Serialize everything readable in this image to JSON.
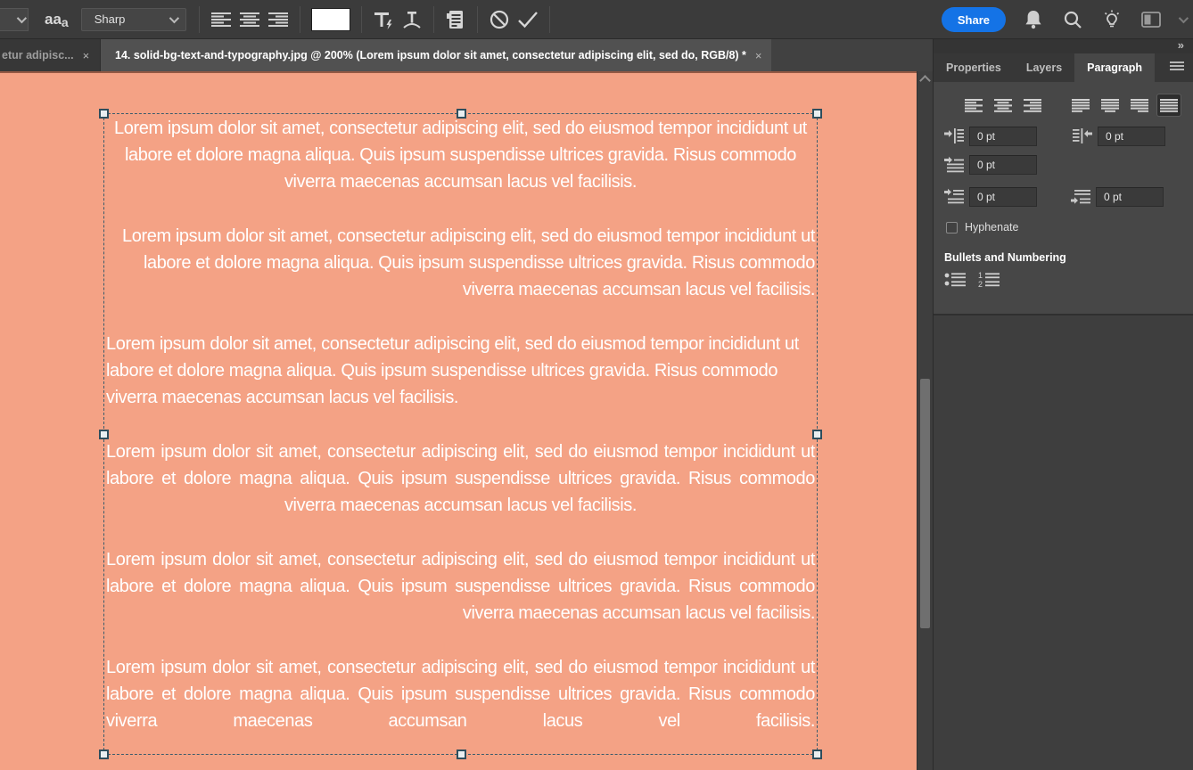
{
  "options_bar": {
    "anti_alias_icon_text": "aa",
    "anti_alias_value": "Sharp",
    "swatch_color": "#ffffff"
  },
  "header_right": {
    "share_label": "Share"
  },
  "document_tabs": {
    "inactive_title": "etur adipisc...",
    "active_title": "14. solid-bg-text-and-typography.jpg @ 200% (Lorem ipsum dolor sit amet, consectetur adipiscing elit, sed do, RGB/8) *",
    "close_glyph": "×"
  },
  "dock": {
    "expand_glyph": "»",
    "tabs": [
      {
        "label": "Properties"
      },
      {
        "label": "Layers"
      },
      {
        "label": "Paragraph"
      }
    ],
    "paragraph_panel": {
      "indent_left": "0 pt",
      "indent_right": "0 pt",
      "indent_first_line": "0 pt",
      "space_before": "0 pt",
      "space_after": "0 pt",
      "hyphenate_label": "Hyphenate",
      "hyphenate_checked": false,
      "bullets_heading": "Bullets and Numbering",
      "selected_alignment": "justify-all"
    }
  },
  "canvas": {
    "background_color": "#F4A285",
    "text_color": "#FFFFFF",
    "zoom_level": "200%",
    "paragraphs": [
      {
        "align": "center",
        "text": "Lorem ipsum dolor sit amet, consectetur adipiscing elit, sed do eiusmod tempor incididunt ut labore et dolore magna aliqua. Quis ipsum suspendisse ultrices gravida. Risus commodo viverra maecenas accumsan lacus vel facilisis."
      },
      {
        "align": "right",
        "text": "Lorem ipsum dolor sit amet, consectetur adipiscing elit, sed do eiusmod tempor incididunt ut labore et dolore magna aliqua. Quis ipsum suspendisse ultrices gravida. Risus commodo viverra maecenas accumsan lacus vel facilisis."
      },
      {
        "align": "left",
        "text": "Lorem ipsum dolor sit amet, consectetur adipiscing elit, sed do eiusmod tempor incididunt ut labore et dolore magna aliqua. Quis ipsum suspendisse ultrices gravida. Risus commodo viverra maecenas accumsan lacus vel facilisis."
      },
      {
        "align": "justify-center",
        "text": "Lorem ipsum dolor sit amet, consectetur adipiscing elit, sed do eiusmod tempor incididunt ut labore et dolore magna aliqua. Quis ipsum suspendisse ultrices gravida. Risus commodo viverra maecenas accumsan lacus vel facilisis."
      },
      {
        "align": "justify-right",
        "text": "Lorem ipsum dolor sit amet, consectetur adipiscing elit, sed do eiusmod tempor incididunt ut labore et dolore magna aliqua. Quis ipsum suspendisse ultrices gravida. Risus commodo viverra maecenas accumsan lacus vel facilisis."
      },
      {
        "align": "justify-all",
        "text": "Lorem ipsum dolor sit amet, consectetur adipiscing elit, sed do eiusmod tempor incididunt ut labore et dolore magna aliqua. Quis ipsum suspendisse ultrices gravida. Risus commodo viverra maecenas accumsan lacus vel facilisis."
      }
    ]
  },
  "colors": {
    "ui_background": "#3B3B3B",
    "panel_background": "#474747",
    "accent_blue": "#1473E6",
    "selection_outline": "#3A5C6C"
  }
}
